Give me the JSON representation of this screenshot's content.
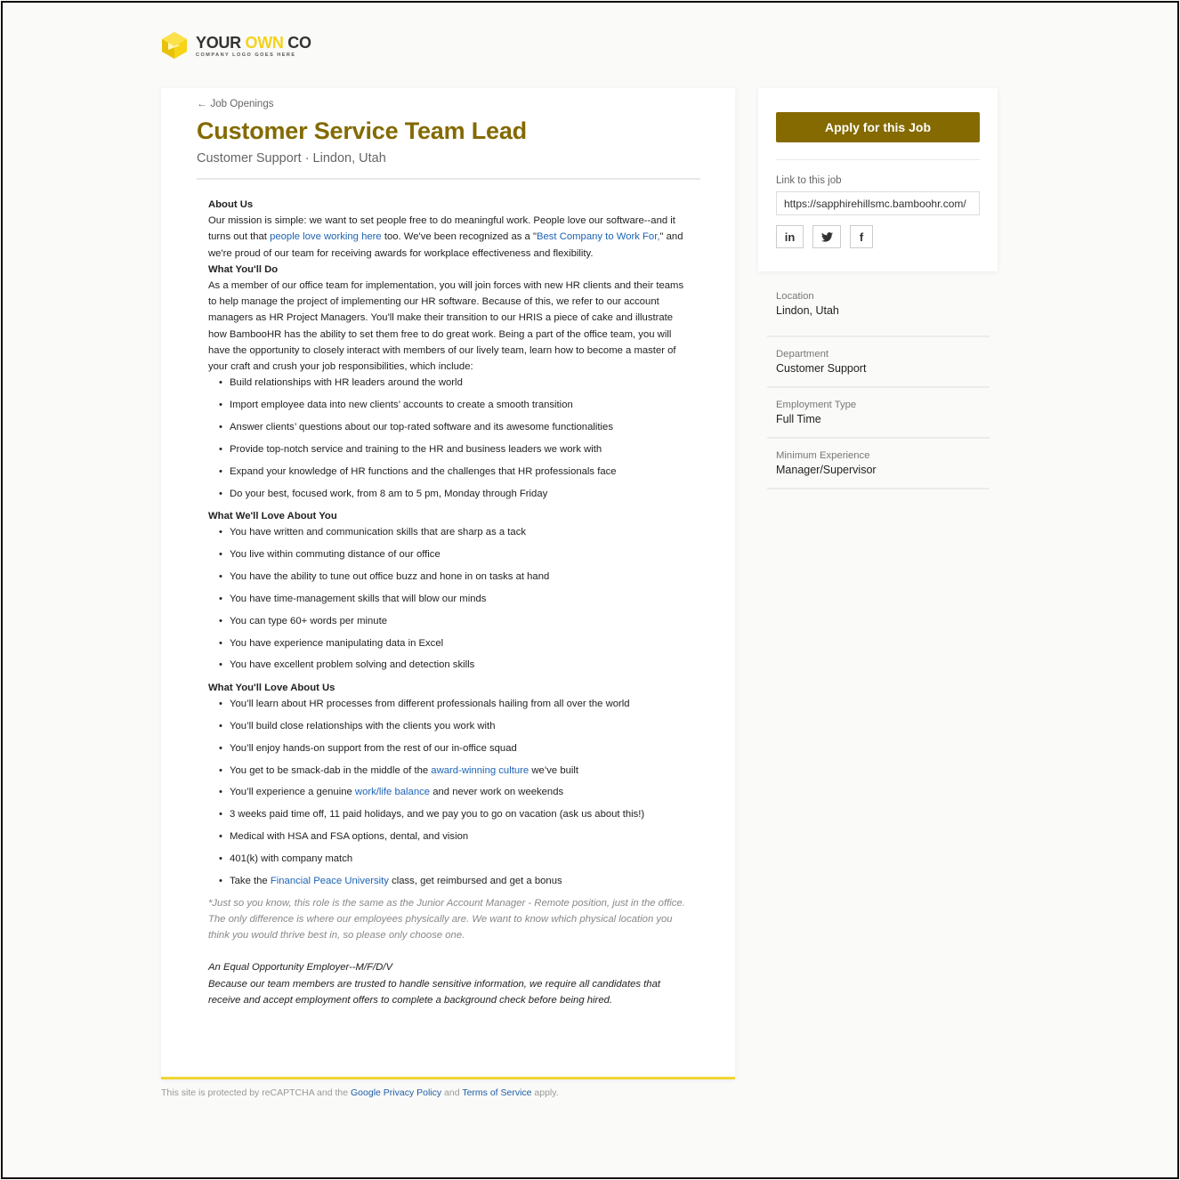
{
  "logo": {
    "name_part1": "YOUR ",
    "name_part2": "OWN",
    "name_part3": " CO",
    "tagline": "COMPANY LOGO GOES HERE",
    "icon": "hexagon-play-logo"
  },
  "breadcrumb": {
    "icon": "arrow-left-icon",
    "arrow": "←",
    "label": "Job Openings"
  },
  "job": {
    "title": "Customer Service Team Lead",
    "subtitle": "Customer Support · Lindon, Utah"
  },
  "description": {
    "about_heading": "About Us",
    "about_text_1": "Our mission is simple: we want to set people free to do meaningful work. People love our software--and it turns out that ",
    "about_link_1": "people love working here",
    "about_text_2": " too. We've been recognized as a \"",
    "about_link_2": "Best Company to Work For,",
    "about_text_3": "\" and we're proud of our team for receiving awards for workplace effectiveness and flexibility.",
    "do_heading": "What You'll Do",
    "do_text": "As a member of our office team for implementation, you will join forces with new HR clients and their teams to help manage the project of implementing our HR software. Because of this, we refer to our account managers as HR Project Managers. You'll make their transition to our HRIS a piece of cake and illustrate how BambooHR has the ability to set them free to do great work. Being a part of the office team, you will have the opportunity to closely interact with members of our lively team, learn how to become a master of your craft and crush your job responsibilities, which include:",
    "do_items": [
      "Build relationships with HR leaders around the world",
      "Import employee data into new clients’ accounts to create a smooth transition",
      "Answer clients’ questions about our top-rated software and its awesome functionalities",
      "Provide top-notch service and training to the HR and business leaders we work with",
      "Expand your knowledge of HR functions and the challenges that HR professionals face",
      "Do your best, focused work, from 8 am to 5 pm, Monday through Friday"
    ],
    "you_heading": "What We'll Love About You",
    "you_items": [
      "You have written and communication skills that are sharp as a tack",
      "You live within commuting distance of our office",
      "You have the ability to tune out office buzz and hone in on tasks at hand",
      "You have time-management skills that will blow our minds",
      "You can type 60+ words per minute",
      "You have experience manipulating data in Excel",
      "You have excellent problem solving and detection skills"
    ],
    "us_heading": "What You'll Love About Us",
    "us_items": [
      {
        "pre": "You’ll learn about HR processes from different professionals hailing from all over the world"
      },
      {
        "pre": "You’ll build close relationships with the clients you work with"
      },
      {
        "pre": "You’ll enjoy hands-on support from the rest of our in-office squad"
      },
      {
        "pre": "You get to be smack-dab in the middle of the ",
        "link": "award-winning culture",
        "post": " we’ve built"
      },
      {
        "pre": "You’ll experience a genuine ",
        "link": "work/life balance",
        "post": " and never work on weekends"
      },
      {
        "pre": "3 weeks paid time off, 11 paid holidays, and we pay you to go on vacation (ask us about this!)"
      },
      {
        "pre": "Medical with HSA and FSA options, dental, and vision"
      },
      {
        "pre": "401(k) with company match"
      },
      {
        "pre": "Take the ",
        "link": "Financial Peace University",
        "post": " class, get reimbursed and get a bonus"
      }
    ],
    "note": "*Just so you know, this role is the same as the Junior Account Manager - Remote position, just in the office. The only difference is where our employees physically are. We want to know which physical location you think you would thrive best in, so please only choose one.",
    "eeo_title": "An Equal Opportunity Employer--M/F/D/V",
    "eeo_text": "Because our team members are trusted to handle sensitive information, we require all candidates that receive and accept employment offers to complete a background check before being hired."
  },
  "sidebar": {
    "apply_label": "Apply for this Job",
    "link_label": "Link to this job",
    "link_value": "https://sapphirehillsmc.bamboohr.com/",
    "share": [
      {
        "icon": "linkedin-icon",
        "glyph": "in"
      },
      {
        "icon": "twitter-icon",
        "glyph": "🐦"
      },
      {
        "icon": "facebook-icon",
        "glyph": "f"
      }
    ],
    "details": [
      {
        "label": "Location",
        "value": "Lindon, Utah"
      },
      {
        "label": "Department",
        "value": "Customer Support"
      },
      {
        "label": "Employment Type",
        "value": "Full Time"
      },
      {
        "label": "Minimum Experience",
        "value": "Manager/Supervisor"
      }
    ]
  },
  "footer": {
    "text_1": "This site is protected by reCAPTCHA and the ",
    "link_1": "Google Privacy Policy",
    "text_2": " and ",
    "link_2": "Terms of Service",
    "text_3": " apply."
  },
  "colors": {
    "accent": "#846a00",
    "title": "#836a00",
    "link": "#1d63b5",
    "logo_yellow": "#f4d21c",
    "card_bottom_border": "#f1d434"
  }
}
